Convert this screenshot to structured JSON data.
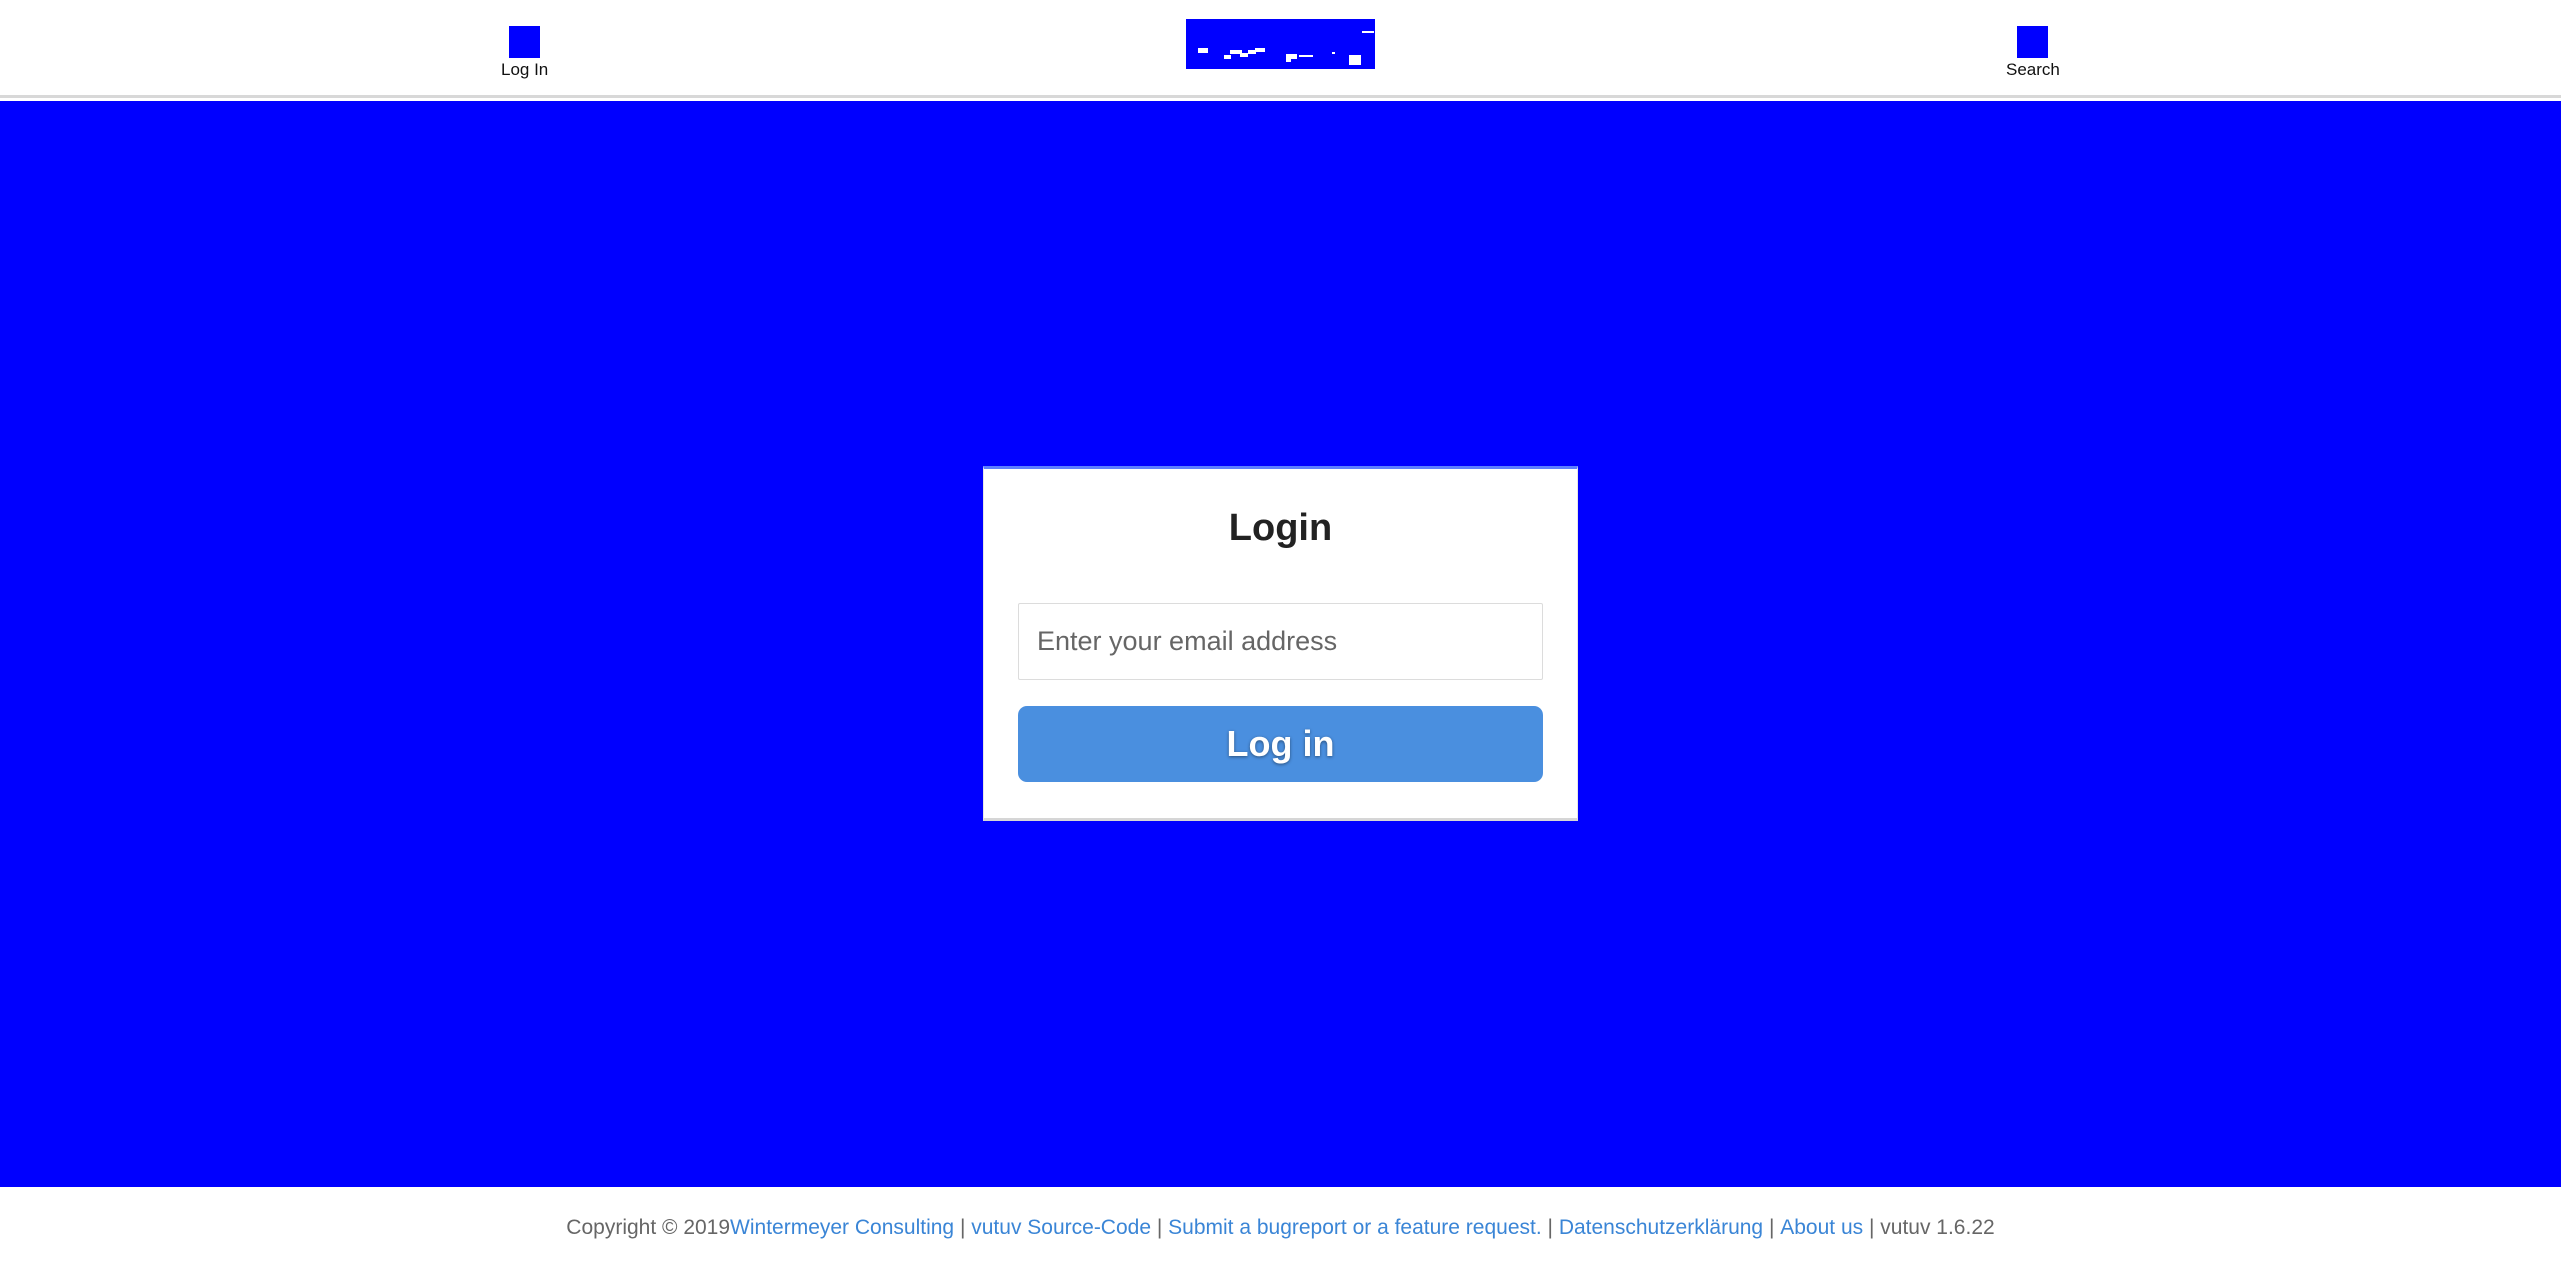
{
  "header": {
    "nav_login_label": "Log In",
    "nav_search_label": "Search",
    "icon_color": "#0000ff"
  },
  "main": {
    "background_color": "#0000ff",
    "login_card": {
      "title": "Login",
      "email_placeholder": "Enter your email address",
      "email_value": "",
      "submit_label": "Log in",
      "button_color": "#4a8fdf"
    }
  },
  "footer": {
    "copyright": "Copyright © 2019 ",
    "links": [
      "Wintermeyer Consulting",
      "vutuv Source-Code",
      "Submit a bugreport or a feature request.",
      "Datenschutzerklärung",
      "About us"
    ],
    "separator": " | ",
    "version": "vutuv 1.6.22",
    "link_color": "#3a85d6"
  }
}
